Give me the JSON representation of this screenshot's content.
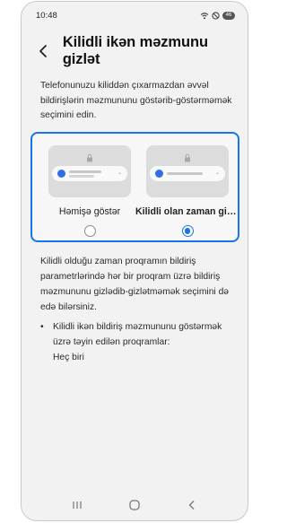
{
  "status_bar": {
    "time": "10:48",
    "battery_level": "46"
  },
  "header": {
    "title": "Kilidli ikən məzmunu gizlət"
  },
  "intro_text": "Telefonunuzu kiliddən çıxarmazdan əvvəl bildirişlərin məzmununu göstərib-göstərməmək seçimini edin.",
  "options": [
    {
      "label": "Həmişə göstər",
      "selected": false
    },
    {
      "label": "Kilidli olan zaman gizlət",
      "selected": true
    }
  ],
  "description": "Kilidli olduğu zaman proqramın bildiriş parametrlərində hər bir proqram üzrə bildiriş məzmununu gizlədib-gizlətməmək seçimini də edə bilərsiniz.",
  "apps_section": {
    "bullet": "•",
    "label": "Kilidli ikən bildiriş məzmununu göstərmək üzrə təyin edilən proqramlar:",
    "value": "Heç biri"
  },
  "colors": {
    "accent": "#1a73e8",
    "background": "#f2f2f2"
  },
  "icons": [
    "back-arrow-icon",
    "lock-icon",
    "recent-apps-icon",
    "home-icon",
    "back-icon"
  ]
}
